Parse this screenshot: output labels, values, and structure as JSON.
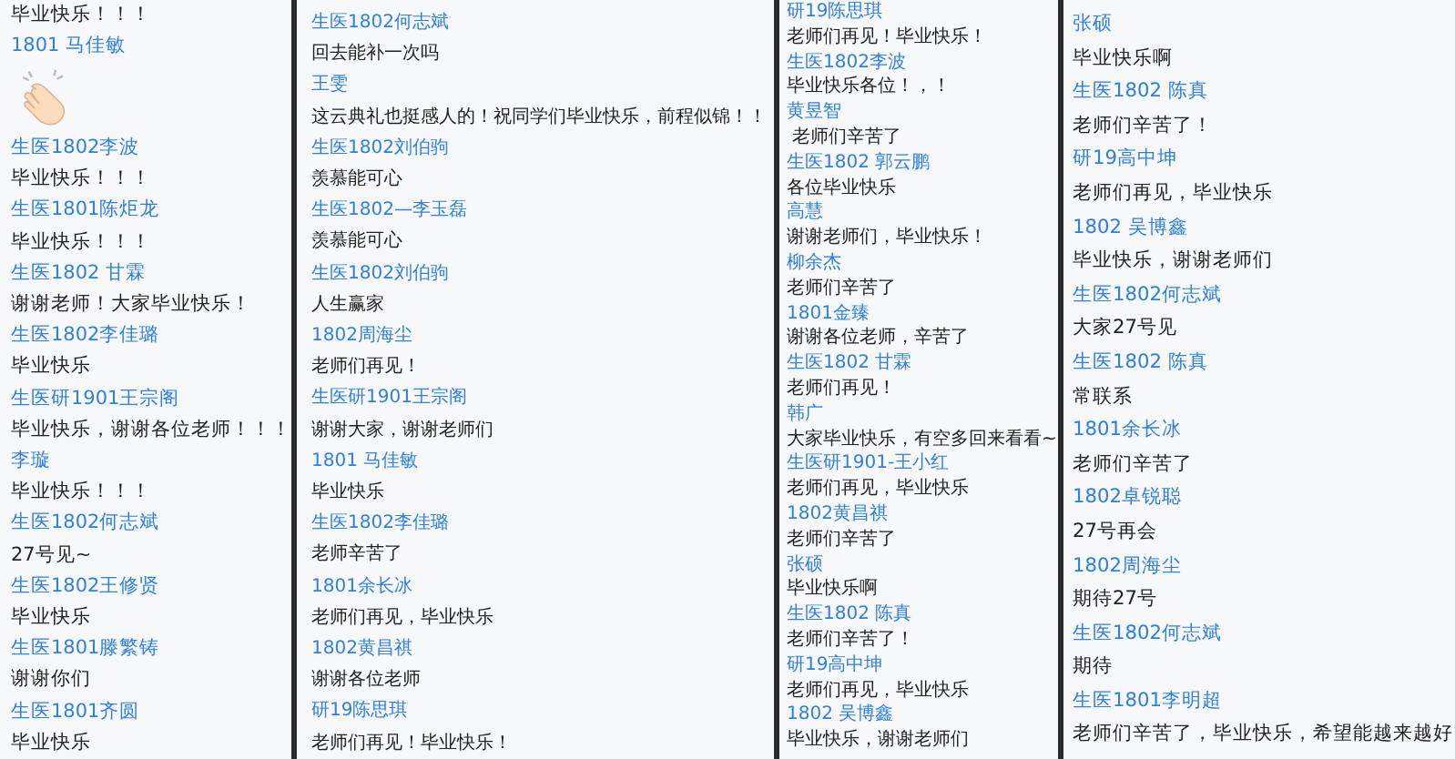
{
  "panels": [
    {
      "entries": [
        {
          "kind": "message",
          "text": "毕业快乐！！！"
        },
        {
          "kind": "name",
          "text": "1801 马佳敏"
        },
        {
          "kind": "emoji"
        },
        {
          "kind": "name",
          "text": "生医1802李波"
        },
        {
          "kind": "message",
          "text": "毕业快乐！！！"
        },
        {
          "kind": "name",
          "text": "生医1801陈炬龙"
        },
        {
          "kind": "message",
          "text": "毕业快乐！！！"
        },
        {
          "kind": "name",
          "text": "生医1802 甘霖"
        },
        {
          "kind": "message",
          "text": "谢谢老师！大家毕业快乐！"
        },
        {
          "kind": "name",
          "text": "生医1802李佳璐"
        },
        {
          "kind": "message",
          "text": "毕业快乐"
        },
        {
          "kind": "name",
          "text": "生医研1901王宗阁"
        },
        {
          "kind": "message",
          "text": "毕业快乐，谢谢各位老师！！！"
        },
        {
          "kind": "name",
          "text": "李璇"
        },
        {
          "kind": "message",
          "text": "毕业快乐！！！"
        },
        {
          "kind": "name",
          "text": "生医1802何志斌"
        },
        {
          "kind": "message",
          "text": "27号见~"
        },
        {
          "kind": "name",
          "text": "生医1802王修贤"
        },
        {
          "kind": "message",
          "text": "毕业快乐"
        },
        {
          "kind": "name",
          "text": "生医1801滕繁铸"
        },
        {
          "kind": "message",
          "text": "谢谢你们"
        },
        {
          "kind": "name",
          "text": "生医1801齐圆"
        },
        {
          "kind": "message",
          "text": "毕业快乐"
        }
      ]
    },
    {
      "entries": [
        {
          "kind": "name",
          "text": "生医1802何志斌"
        },
        {
          "kind": "message",
          "text": "回去能补一次吗"
        },
        {
          "kind": "name",
          "text": "王雯"
        },
        {
          "kind": "message",
          "text": "这云典礼也挺感人的！祝同学们毕业快乐，前程似锦！！"
        },
        {
          "kind": "name",
          "text": "生医1802刘伯驹"
        },
        {
          "kind": "message",
          "text": "羡慕能可心"
        },
        {
          "kind": "name",
          "text": "生医1802—李玉磊"
        },
        {
          "kind": "message",
          "text": "羡慕能可心"
        },
        {
          "kind": "name",
          "text": "生医1802刘伯驹"
        },
        {
          "kind": "message",
          "text": "人生赢家"
        },
        {
          "kind": "name",
          "text": "1802周海尘"
        },
        {
          "kind": "message",
          "text": "老师们再见！"
        },
        {
          "kind": "name",
          "text": "生医研1901王宗阁"
        },
        {
          "kind": "message",
          "text": "谢谢大家，谢谢老师们"
        },
        {
          "kind": "name",
          "text": "1801 马佳敏"
        },
        {
          "kind": "message",
          "text": "毕业快乐"
        },
        {
          "kind": "name",
          "text": "生医1802李佳璐"
        },
        {
          "kind": "message",
          "text": "老师辛苦了"
        },
        {
          "kind": "name",
          "text": "1801余长冰"
        },
        {
          "kind": "message",
          "text": "老师们再见，毕业快乐"
        },
        {
          "kind": "name",
          "text": "1802黄昌祺"
        },
        {
          "kind": "message",
          "text": "谢谢各位老师"
        },
        {
          "kind": "name",
          "text": "研19陈思琪"
        },
        {
          "kind": "message",
          "text": "老师们再见！毕业快乐！"
        }
      ]
    },
    {
      "entries": [
        {
          "kind": "name",
          "text": "研19陈思琪"
        },
        {
          "kind": "message",
          "text": "老师们再见！毕业快乐！"
        },
        {
          "kind": "name",
          "text": "生医1802李波"
        },
        {
          "kind": "message",
          "text": "毕业快乐各位！，！"
        },
        {
          "kind": "name",
          "text": "黄昱智"
        },
        {
          "kind": "message",
          "text": " 老师们辛苦了"
        },
        {
          "kind": "name",
          "text": "生医1802 郭云鹏"
        },
        {
          "kind": "message",
          "text": "各位毕业快乐"
        },
        {
          "kind": "name",
          "text": "高慧"
        },
        {
          "kind": "message",
          "text": "谢谢老师们，毕业快乐！"
        },
        {
          "kind": "name",
          "text": "柳余杰"
        },
        {
          "kind": "message",
          "text": "老师们辛苦了"
        },
        {
          "kind": "name",
          "text": "1801金臻"
        },
        {
          "kind": "message",
          "text": "谢谢各位老师，辛苦了"
        },
        {
          "kind": "name",
          "text": "生医1802 甘霖"
        },
        {
          "kind": "message",
          "text": "老师们再见！"
        },
        {
          "kind": "name",
          "text": "韩广"
        },
        {
          "kind": "message",
          "text": "大家毕业快乐，有空多回来看看~"
        },
        {
          "kind": "name",
          "text": "生医研1901-王小红"
        },
        {
          "kind": "message",
          "text": "老师们再见，毕业快乐"
        },
        {
          "kind": "name",
          "text": "1802黄昌祺"
        },
        {
          "kind": "message",
          "text": "老师们辛苦了"
        },
        {
          "kind": "name",
          "text": "张硕"
        },
        {
          "kind": "message",
          "text": "毕业快乐啊"
        },
        {
          "kind": "name",
          "text": "生医1802 陈真"
        },
        {
          "kind": "message",
          "text": "老师们辛苦了！"
        },
        {
          "kind": "name",
          "text": "研19高中坤"
        },
        {
          "kind": "message",
          "text": "老师们再见，毕业快乐"
        },
        {
          "kind": "name",
          "text": "1802 吴博鑫"
        },
        {
          "kind": "message",
          "text": "毕业快乐，谢谢老师们"
        }
      ]
    },
    {
      "entries": [
        {
          "kind": "name",
          "text": "张硕"
        },
        {
          "kind": "message",
          "text": "毕业快乐啊"
        },
        {
          "kind": "name",
          "text": "生医1802 陈真"
        },
        {
          "kind": "message",
          "text": "老师们辛苦了！"
        },
        {
          "kind": "name",
          "text": "研19高中坤"
        },
        {
          "kind": "message",
          "text": "老师们再见，毕业快乐"
        },
        {
          "kind": "name",
          "text": "1802 吴博鑫"
        },
        {
          "kind": "message",
          "text": "毕业快乐，谢谢老师们"
        },
        {
          "kind": "name",
          "text": "生医1802何志斌"
        },
        {
          "kind": "message",
          "text": "大家27号见"
        },
        {
          "kind": "name",
          "text": "生医1802 陈真"
        },
        {
          "kind": "message",
          "text": "常联系"
        },
        {
          "kind": "name",
          "text": "1801余长冰"
        },
        {
          "kind": "message",
          "text": "老师们辛苦了"
        },
        {
          "kind": "name",
          "text": "1802卓锐聪"
        },
        {
          "kind": "message",
          "text": "27号再会"
        },
        {
          "kind": "name",
          "text": "1802周海尘"
        },
        {
          "kind": "message",
          "text": "期待27号"
        },
        {
          "kind": "name",
          "text": "生医1802何志斌"
        },
        {
          "kind": "message",
          "text": "期待"
        },
        {
          "kind": "name",
          "text": "生医1801李明超"
        },
        {
          "kind": "message",
          "text": "老师们辛苦了，毕业快乐，希望能越来越好"
        }
      ]
    }
  ]
}
